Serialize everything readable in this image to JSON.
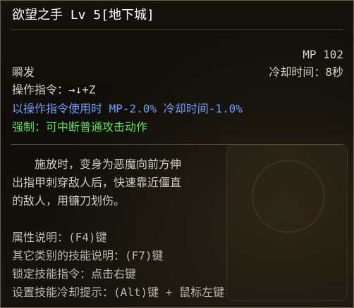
{
  "skill": {
    "title": "欲望之手 Lv 5[地下城]",
    "mp": "MP 102",
    "cooldown": "冷却时间：8秒",
    "cast_type": "瞬发",
    "command": "操作指令：→↓+Z",
    "command_bonus": "以操作指令使用时 MP-2.0% 冷却时间-1.0%",
    "force": "强制：可中断普通攻击动作"
  },
  "description": [
    "　　施放时，变身为恶魔向前方伸",
    "出指甲刺穿敌人后，快速靠近僵直",
    "的敌人，用镰刀划伤。"
  ],
  "hints": [
    "属性说明：(F4)键",
    "其它类别的技能说明：(F7)键",
    "锁定技能指令：点击右键",
    "设置技能冷却提示：(Alt)键 + 鼠标左键"
  ],
  "colors": {
    "title": "#ffffff",
    "bonus": "#6f9dff",
    "force": "#5fe05a"
  }
}
